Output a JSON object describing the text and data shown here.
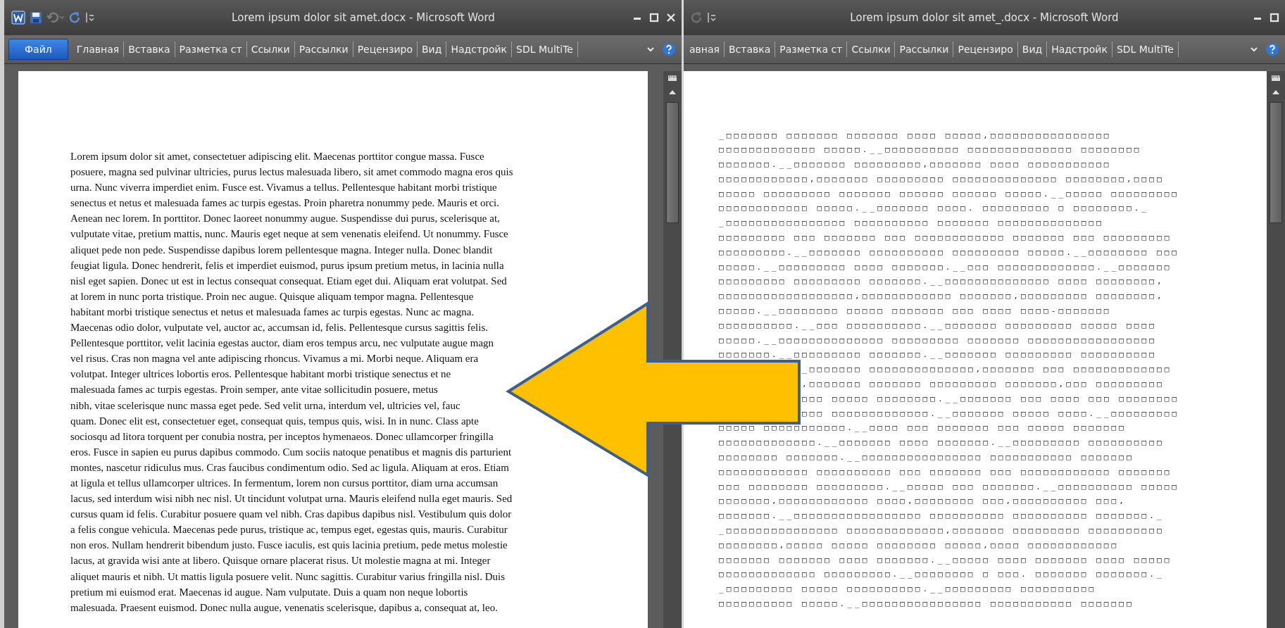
{
  "windows": [
    {
      "title": "Lorem ipsum dolor sit amet.docx - Microsoft Word",
      "file_button": "Файл",
      "tabs": [
        {
          "label": "Главная",
          "selected": false
        },
        {
          "label": "Вставка",
          "selected": false
        },
        {
          "label": "Разметка ст",
          "selected": false
        },
        {
          "label": "Ссылки",
          "selected": false
        },
        {
          "label": "Рассылки",
          "selected": false
        },
        {
          "label": "Рецензиро",
          "selected": false
        },
        {
          "label": "Вид",
          "selected": false
        },
        {
          "label": "Надстройк",
          "selected": false
        },
        {
          "label": "SDL MultiTe",
          "selected": false
        }
      ],
      "kind": "text",
      "lines": [
        "Lorem ipsum dolor sit amet, consectetuer adipiscing elit. Maecenas porttitor congue massa. Fusce",
        "posuere, magna sed pulvinar ultricies, purus lectus malesuada libero, sit amet commodo magna eros quis",
        "urna. Nunc viverra imperdiet enim. Fusce est. Vivamus a tellus. Pellentesque habitant morbi tristique",
        "senectus et netus et malesuada fames ac turpis egestas. Proin pharetra nonummy pede. Mauris et orci.",
        "Aenean nec lorem. In porttitor. Donec laoreet nonummy augue. Suspendisse dui purus, scelerisque at,",
        "vulputate vitae, pretium mattis, nunc. Mauris eget neque at sem venenatis eleifend. Ut nonummy. Fusce",
        "aliquet pede non pede. Suspendisse dapibus lorem pellentesque magna. Integer nulla. Donec blandit",
        "feugiat ligula. Donec hendrerit, felis et imperdiet euismod, purus ipsum pretium metus, in lacinia nulla",
        "nisl eget sapien. Donec ut est in lectus consequat consequat. Etiam eget dui. Aliquam erat volutpat. Sed",
        "at lorem in nunc porta tristique. Proin nec augue. Quisque aliquam tempor magna. Pellentesque",
        "habitant morbi tristique senectus et netus et malesuada fames ac turpis egestas. Nunc ac magna.",
        "Maecenas odio dolor, vulputate vel, auctor ac, accumsan id, felis. Pellentesque cursus sagittis felis.",
        "Pellentesque porttitor, velit lacinia egestas auctor, diam eros tempus arcu, nec vulputate augue magn",
        "vel risus. Cras non magna vel ante adipiscing rhoncus. Vivamus a mi. Morbi neque. Aliquam era",
        "volutpat. Integer ultrices lobortis eros. Pellentesque habitant morbi tristique senectus et ne",
        "malesuada fames ac turpis egestas. Proin semper, ante vitae sollicitudin posuere, metus",
        "nibh, vitae scelerisque nunc massa eget pede. Sed velit urna, interdum vel, ultricies vel, fauc",
        "quam. Donec elit est, consectetuer eget, consequat quis, tempus quis, wisi. In in nunc. Class apte",
        "sociosqu ad litora torquent per conubia nostra, per inceptos hymenaeos. Donec ullamcorper fringilla",
        "eros. Fusce in sapien eu purus dapibus commodo. Cum sociis natoque penatibus et magnis dis parturient",
        "montes, nascetur ridiculus mus. Cras faucibus condimentum odio. Sed ac ligula. Aliquam at eros. Etiam",
        "at ligula et tellus ullamcorper ultrices. In fermentum, lorem non cursus porttitor, diam urna accumsan",
        "lacus, sed interdum wisi nibh nec nisl. Ut tincidunt volutpat urna. Mauris eleifend nulla eget mauris. Sed",
        "cursus quam id felis. Curabitur posuere quam vel nibh. Cras dapibus dapibus nisl. Vestibulum quis dolor",
        "a felis congue vehicula. Maecenas pede purus, tristique ac, tempus eget, egestas quis, mauris. Curabitur",
        "non eros. Nullam hendrerit bibendum justo. Fusce iaculis, est quis lacinia pretium, pede metus molestie",
        "lacus, at gravida wisi ante at libero. Quisque ornare placerat risus. Ut molestie magna at mi. Integer",
        "aliquet mauris et nibh. Ut mattis ligula posuere velit. Nunc sagittis. Curabitur varius fringilla nisl. Duis",
        "pretium mi euismod erat. Maecenas id augue. Nam vulputate. Duis a quam non neque lobortis",
        "malesuada. Praesent euismod. Donec nulla augue, venenatis scelerisque, dapibus a, consequat at, leo."
      ]
    },
    {
      "title": "Lorem ipsum dolor sit amet_.docx - Microsoft Word",
      "tabs": [
        {
          "label": "авная",
          "selected": false
        },
        {
          "label": "Вставка",
          "selected": false
        },
        {
          "label": "Разметка ст",
          "selected": false
        },
        {
          "label": "Ссылки",
          "selected": false
        },
        {
          "label": "Рассылки",
          "selected": false
        },
        {
          "label": "Рецензиро",
          "selected": false
        },
        {
          "label": "Вид",
          "selected": false
        },
        {
          "label": "Надстройк",
          "selected": false
        },
        {
          "label": "SDL MultiTe",
          "selected": false
        }
      ],
      "kind": "boxes",
      "lines_above_arrow": [
        "_□□□□□□□ □□□□□□□ □□□□□□□ □□□□ □□□□□,□□□□□□□□□□□□□□□□",
        "□□□□□□□□□□□□□ □□□□□.__□□□□□□□□□□ □□□□□□□□□□□□□□ □□□□□□□□",
        "□□□□□□□.__□□□□□□□ □□□□□□□□□,□□□□□□□ □□□□ □□□□□□□□□□□",
        "□□□□□□□□□□□□,□□□□□□□ □□□□□□□□□ □□□□□□□□□□□□□□ □□□□□□□□,□□□□",
        "□□□□□ □□□□□□□□□ □□□□□□□ □□□□□□ □□□□□□ □□□□□.__□□□□□ □□□□□□□□□",
        "□□□□□□□□□□□□ □□□□□.__□□□□□□□ □□□□. □□□□□□□□□ □ □□□□□□□□._",
        "_□□□□□□□□□□□□□□□□ □□□□□□□□□□ □□□□□□□ □□□□□□□□□□□□□□",
        "□□□□□□□□□ □□□ □□□□□□□ □□□ □□□□□□□□□□□□ □□□□□□□ □□□ □□□□□□□□□",
        "□□□□□□□□□.__□□□□□□□ □□□□□□□□□□ □□□□□□□□□ □□□□□.__□□□□□□□□ □□□",
        "□□□□□.__□□□□□□□□□ □□□□ □□□□□□□.__□□□ □□□□□□□□□□□□□.__□□□□□□□",
        "□□□□□□□□□ □□□□□□□□□ □□□□□□□.__□□□□□□□□□□□□□□ □□□□ □□□□□□□□,",
        "□□□□□□□□□□□□□□□□□□,□□□□□□□□□□□□ □□□□□□□,□□□□□□□□□ □□□□□□□□,",
        "□□□□□.__□□□□□□□□ □□□□□ □□□□□□□ □□□ □□□□ □□□□-□□□□□□□",
        "□□□□□□□□□□.__□□□ □□□□□□□□□□.__□□□□□□□ □□□□□□□□□ □□□□□ □□□□",
        "□□□□□.__□□□□□□□□□□□□□□ □□□□□□□□□ □□□□□□□ □□□□□□□□□□□□□□□□□",
        "□□□□□□□.__□□□□□□□□□ □□□□□□□.__□□□□□□□ □□□□□□□□□ □□□□□□□□□□"
      ],
      "lines_beside_arrow": [
        "_□□□□□□□ □□□□□□□□□□□□□□,□□□□□□□ □□□ □□□□□□□□□□□□□",
        ",□□□□□□□ □□□□□□□ □□□□□□□□□ □□□□□□□,□□□ □□□□□□□□□",
        "□□□ □□□□□ □□□□□□□□.__□□□□□□□ □□□ □□□□ □□□ □□□□□□□□",
        "□□□ □□□□□□□□□□□□□.__□□□□□□□ □□□□□ □□□□.__□□□□□□□□□"
      ],
      "lines_below_arrow": [
        "□□□□□ □□□□□□□□□□□.__□□□□ □□□ □□□□□□□ □□□ □□□□□ □□□□□□□",
        "□□□□□□□□□□□□□.__□□□□□□□ □□□□ □□□□□□□.__□□□□□□□□□ □□□□□□□□□□",
        "□□□□□□□□ □□□□□□□.__□□□□□□□□□□□□□□□□ □□□□□□□□□□□ □□□□□□□",
        "□□□□□□□□□□□□ □□□□□□□□□□ □□□ □□□□□□□ □□□ □□□□□□□□□□□□ □□□□□□□",
        "□□□ □□□□□□□□ □□□□□□□□□.__□□□□□ □□□ □□□□□□□.__□□□□□□□□□□ □□□□□",
        "□□□□□□□,□□□□□□□□□□□□ □□□□,□□□□□□□□ □□□,□□□□□□□□□□ □□□,",
        "□□□□□□□.__□□□□□□□□□□□□□□□□□ □□□□□□□□□□ □□□□□□□□□□ □□□□□□□._",
        "_□□□□□□□□□□□□□□□ □□□□□□□□□□□□□,□□□□□□□ □□□□□□□□□ □□□□□□□□□□",
        "□□□□□□□□,□□□□□ □□□□□ □□□□□□□□ □□□□□,□□□□ □□□□□□□□□□□□",
        "□□□□□□□ □□□□□□□ □□□□ □□□□□□□.__□□□□□ □□□□ □□□□□□□ □□□□ □□□□□",
        "□□□□□□□□□□□□□ □□□□□□□□□.__□□□□□□□□ □ □□□. □□□□□□□ □□□□□□□._",
        "_□□□□□□□□□ □□□□□ □□□□□□□□□□.__□□□□□□□□□ □□□□□□□□□□",
        "□□□□□□□□□□ □□□□□.__□□□□□□□□□□□□□□□□ □□□□□□□□□□□ □□□□□□□"
      ]
    }
  ]
}
